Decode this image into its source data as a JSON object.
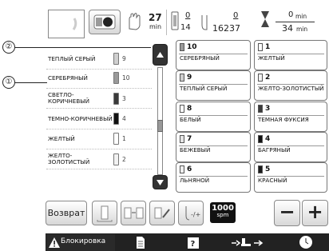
{
  "status": {
    "stitch_unit": "min",
    "stitch_value": "27",
    "needle_current": "0",
    "needle_total": "14",
    "stitch_current": "0",
    "stitch_total": "16237",
    "time_current": "0",
    "time_unit": "min",
    "time_total": "34",
    "time_total_unit": "min"
  },
  "callouts": {
    "one": "①",
    "two": "②"
  },
  "color_list": [
    {
      "name": "ТЕПЛЫЙ СЕРЫЙ",
      "no": "9",
      "color": "#cfcfcf"
    },
    {
      "name": "СЕРЕБРЯНЫЙ",
      "no": "10",
      "color": "#9a9a9a"
    },
    {
      "name": "СВЕТЛО-КОРИЧНЕВЫЙ",
      "no": "3",
      "color": "#3a3a3a"
    },
    {
      "name": "ТЕМНО-КОРИЧНЕВЫЙ",
      "no": "4",
      "color": "#111111"
    },
    {
      "name": "ЖЕЛТЫЙ",
      "no": "1",
      "color": "#ffffff"
    },
    {
      "name": "ЖЕЛТО-ЗОЛОТИСТЫЙ",
      "no": "2",
      "color": "#f2f2f2"
    }
  ],
  "threads": [
    {
      "no": "10",
      "name": "СЕРЕБРЯНЫЙ",
      "color": "#9a9a9a"
    },
    {
      "no": "1",
      "name": "ЖЕЛТЫЙ",
      "color": "#ffffff"
    },
    {
      "no": "9",
      "name": "ТЕПЛЫЙ СЕРЫЙ",
      "color": "#cfcfcf"
    },
    {
      "no": "2",
      "name": "ЖЕЛТО-ЗОЛОТИСТЫЙ",
      "color": "#f2f2f2"
    },
    {
      "no": "8",
      "name": "БЕЛЫЙ",
      "color": "#ffffff"
    },
    {
      "no": "3",
      "name": "ТЕМНАЯ ФУКСИЯ",
      "color": "#3a3a3a"
    },
    {
      "no": "7",
      "name": "БЕЖЕВЫЙ",
      "color": "#e6e6e6"
    },
    {
      "no": "4",
      "name": "БАГРЯНЫЙ",
      "color": "#111111"
    },
    {
      "no": "6",
      "name": "ЛЬНЯНОЙ",
      "color": "#efefef"
    },
    {
      "no": "5",
      "name": "КРАСНЫЙ",
      "color": "#1a1a1a"
    }
  ],
  "toolbar": {
    "back_label": "Возврат",
    "speed_value": "1000",
    "speed_unit": "spm",
    "minus_label": "−",
    "plus_label": "+"
  },
  "bottom_bar": {
    "lock_label": "Блокировка"
  }
}
